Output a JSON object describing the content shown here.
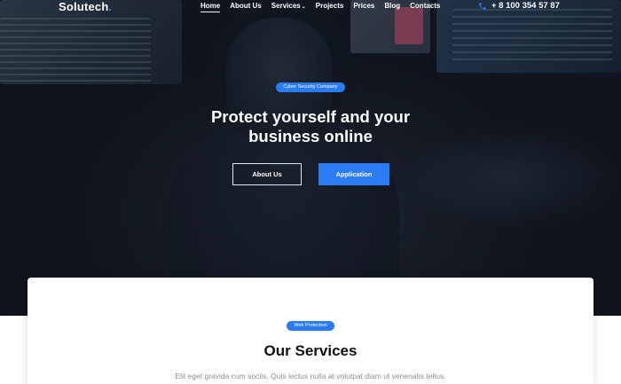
{
  "brand": {
    "name": "Solutech",
    "dot": "."
  },
  "nav": {
    "items": [
      {
        "label": "Home",
        "active": true
      },
      {
        "label": "About Us"
      },
      {
        "label": "Services",
        "has_dropdown": true
      },
      {
        "label": "Projects"
      },
      {
        "label": "Prices"
      },
      {
        "label": "Blog"
      },
      {
        "label": "Contacts"
      }
    ],
    "phone": "+ 8 100 354 57 87",
    "phone_icon": "phone-icon"
  },
  "hero": {
    "badge": "Cyber Security Company",
    "title": "Protect yourself and your business online",
    "buttons": {
      "about": "About Us",
      "application": "Application"
    }
  },
  "services": {
    "badge": "Web Protection",
    "title": "Our Services",
    "subtitle": "Elit eget gravida cum sociis. Quis lectus nulla at volutpat diam ut venenatis tellus."
  },
  "colors": {
    "accent": "#2a7bf4",
    "hero_bg": "#161c28",
    "subtitle": "#8a8f98"
  }
}
